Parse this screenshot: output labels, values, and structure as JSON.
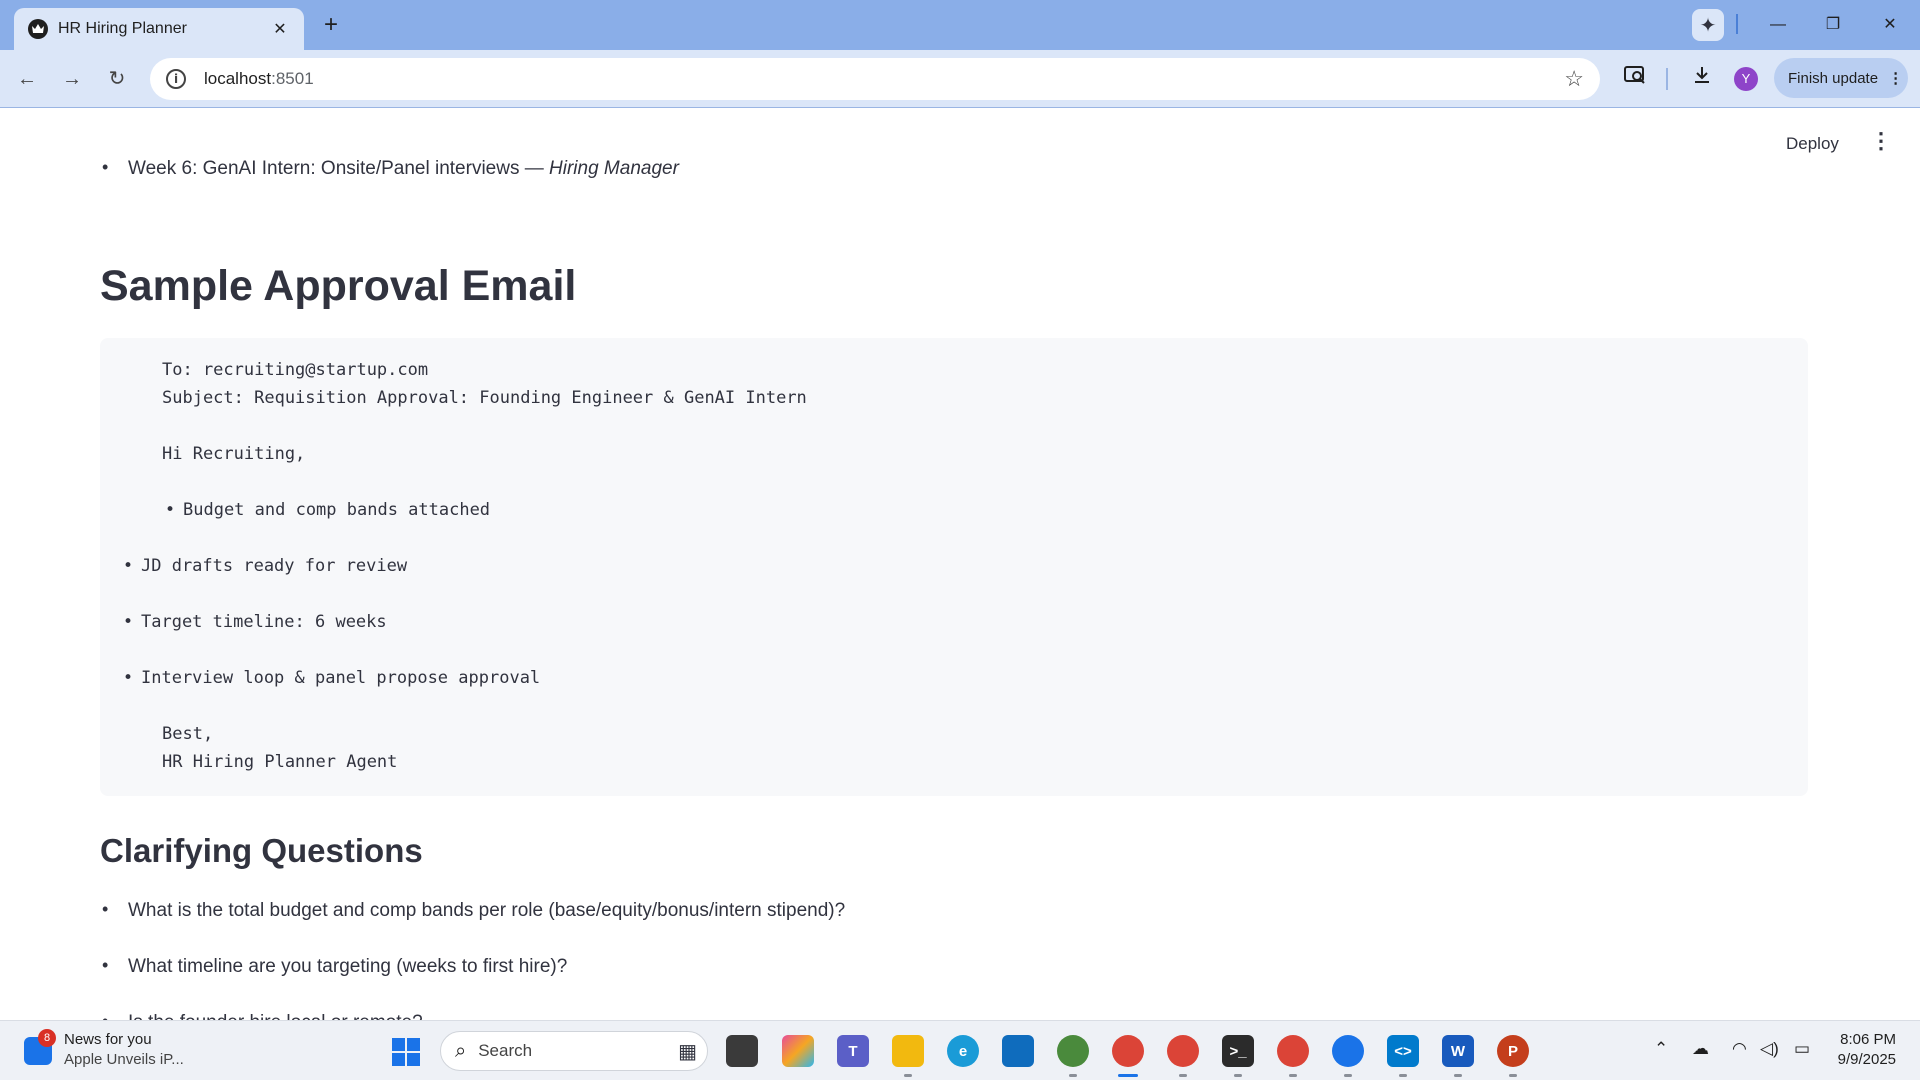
{
  "browser": {
    "tab_title": "HR Hiring Planner",
    "tab_close": "✕",
    "new_tab": "+",
    "url_host": "localhost",
    "url_port": ":8501",
    "finish_update": "Finish update",
    "avatar_letter": "Y"
  },
  "app": {
    "deploy_label": "Deploy",
    "menu_glyph": "⋮"
  },
  "content": {
    "top_bullet_text": "Week 6: GenAI Intern: Onsite/Panel interviews — ",
    "top_bullet_owner": "Hiring Manager",
    "email_heading": "Sample Approval Email",
    "email_lines": {
      "to": "To: recruiting@startup.com",
      "subject": "Subject: Requisition Approval: Founding Engineer & GenAI Intern",
      "greeting": "Hi Recruiting,",
      "bullet_1": "Budget and comp bands attached",
      "bullet_2": "JD drafts ready for review",
      "bullet_3": "Target timeline: 6 weeks",
      "bullet_4": "Interview loop & panel propose approval",
      "closing": "Best,",
      "signature": "HR Hiring Planner Agent"
    },
    "questions_heading": "Clarifying Questions",
    "questions": [
      "What is the total budget and comp bands per role (base/equity/bonus/intern stipend)?",
      "What timeline are you targeting (weeks to first hire)?",
      "Is the founder hire local or remote?"
    ]
  },
  "taskbar": {
    "news_badge": "8",
    "news_title": "News for you",
    "news_subtitle": "Apple Unveils iP...",
    "search_placeholder": "Search",
    "clock_time": "8:06 PM",
    "clock_date": "9/9/2025"
  },
  "colors": {
    "tab_strip": "#8aaee8",
    "toolbar": "#dbe6f8",
    "code_background": "#f7f8fa",
    "text": "#31333f"
  }
}
